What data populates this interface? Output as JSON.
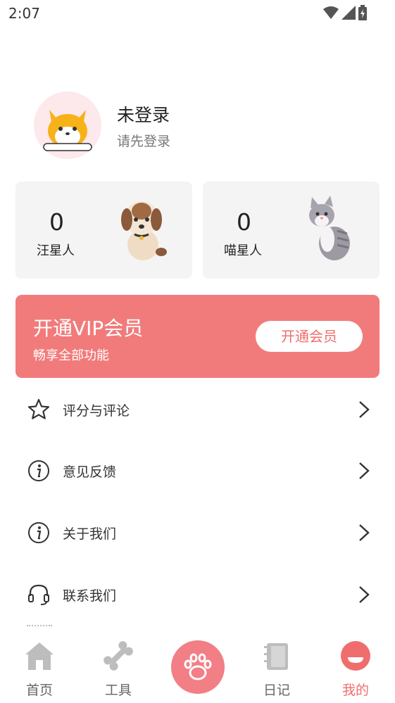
{
  "status_bar": {
    "time": "2:07"
  },
  "profile": {
    "name": "未登录",
    "subtitle": "请先登录"
  },
  "pets": [
    {
      "count": "0",
      "label": "汪星人"
    },
    {
      "count": "0",
      "label": "喵星人"
    }
  ],
  "vip": {
    "title": "开通VIP会员",
    "subtitle": "畅享全部功能",
    "button": "开通会员",
    "color": "#f17b7b"
  },
  "menu": [
    {
      "label": "评分与评论",
      "icon": "star-icon"
    },
    {
      "label": "意见反馈",
      "icon": "info-icon"
    },
    {
      "label": "关于我们",
      "icon": "info-icon"
    },
    {
      "label": "联系我们",
      "icon": "headset-icon"
    }
  ],
  "tabs": [
    {
      "label": "首页",
      "icon": "home-icon"
    },
    {
      "label": "工具",
      "icon": "bone-icon"
    },
    {
      "label": "",
      "icon": "paw-icon"
    },
    {
      "label": "日记",
      "icon": "notebook-icon"
    },
    {
      "label": "我的",
      "icon": "profile-icon",
      "active": true
    }
  ],
  "colors": {
    "accent": "#f06d6d",
    "tab_inactive": "#bdbdbd"
  }
}
